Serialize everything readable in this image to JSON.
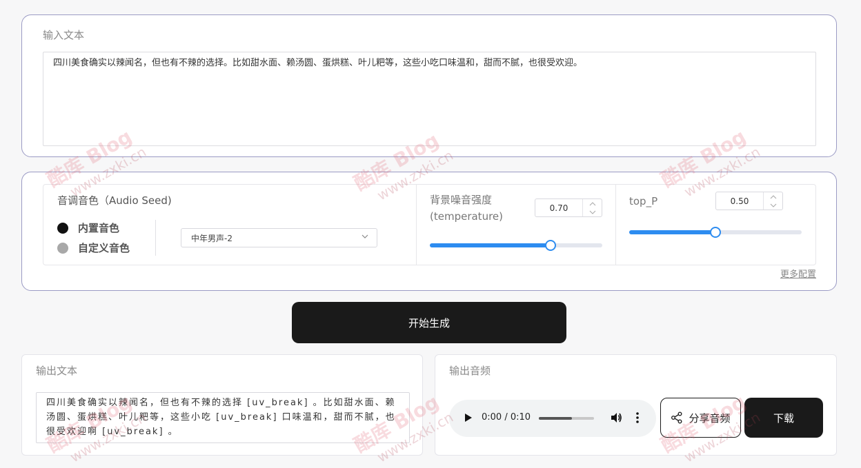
{
  "input": {
    "label": "输入文本",
    "text": "四川美食确实以辣闻名，但也有不辣的选择。比如甜水面、赖汤圆、蛋烘糕、叶儿粑等，这些小吃口味温和，甜而不腻，也很受欢迎。"
  },
  "config": {
    "voice_title": "音调音色（Audio Seed)",
    "radio_builtin": "内置音色",
    "radio_custom": "自定义音色",
    "voice_selected": "中年男声-2",
    "temperature_label": "背景噪音强度(temperature)",
    "temperature_value": "0.70",
    "temperature_level": 0.7,
    "top_p_label": "top_P",
    "top_p_value": "0.50",
    "top_p_level": 0.5,
    "more_link": "更多配置"
  },
  "generate_label": "开始生成",
  "output_text": {
    "label": "输出文本",
    "text": "四川美食确实以辣闻名，但也有不辣的选择 [uv_break] 。比如甜水面、赖汤圆、蛋烘糕、叶儿粑等，这些小吃 [uv_break] 口味温和，甜而不腻，也很受欢迎啊 [uv_break] 。"
  },
  "output_audio": {
    "label": "输出音频",
    "time": "0:00 / 0:10",
    "progress": 0.6,
    "share_label": "分享音频",
    "download_label": "下载"
  },
  "watermark": {
    "brand": "酷库 Blog",
    "url": "www.zxki.cn"
  },
  "colors": {
    "accent": "#2d8cf0",
    "button_dark": "#1a1a1a"
  },
  "icons": {
    "chevron": "chevron-down-icon",
    "play": "play-icon",
    "volume": "volume-icon",
    "more": "more-vertical-icon",
    "share": "share-icon"
  }
}
